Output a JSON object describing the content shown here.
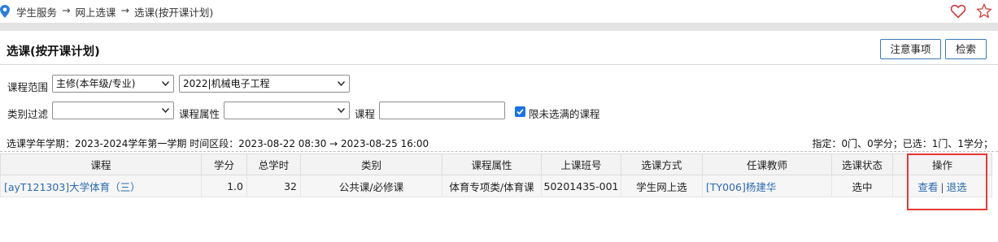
{
  "breadcrumb": {
    "items": [
      "学生服务",
      "网上选课",
      "选课(按开课计划)"
    ],
    "separator": "→"
  },
  "header": {
    "title": "选课(按开课计划)",
    "notice_button": "注意事项",
    "search_button": "检索"
  },
  "filters": {
    "scope_label": "课程范围",
    "scope_value": "主修(本年级/专业)",
    "plan_value": "2022|机械电子工程",
    "category_label": "类别过滤",
    "category_value": "",
    "attr_label": "课程属性",
    "attr_value": "",
    "course_label": "课程",
    "course_value": "",
    "only_unfull_label": "限未选满的课程",
    "only_unfull_checked": true
  },
  "info": {
    "term": "选课学年学期：2023-2024学年第一学期  时间区段：2023-08-22 08:30 → 2023-08-25 16:00",
    "summary": "指定：0门、0学分；已选：1门、1学分；"
  },
  "table": {
    "headers": [
      "课程",
      "学分",
      "总学时",
      "类别",
      "课程属性",
      "上课班号",
      "选课方式",
      "任课教师",
      "选课状态",
      "操作"
    ],
    "rows": [
      {
        "course": "[ayT121303]大学体育（三）",
        "credit": "1.0",
        "hours": "32",
        "category": "公共课/必修课",
        "attribute": "体育专项类/体育课",
        "class_no": "50201435-001",
        "method": "学生网上选",
        "teacher": "[TY006]杨建华",
        "status": "选中",
        "op_view": "查看",
        "op_drop": "退选"
      }
    ]
  },
  "colors": {
    "accent": "#3a78b8",
    "link": "#2a6bb0",
    "highlight": "#e53935",
    "checkbox": "#1a73e8"
  },
  "icons": [
    "location-icon",
    "heart-icon",
    "star-icon",
    "dropdown-arrow-icon",
    "checkbox-check-icon"
  ]
}
